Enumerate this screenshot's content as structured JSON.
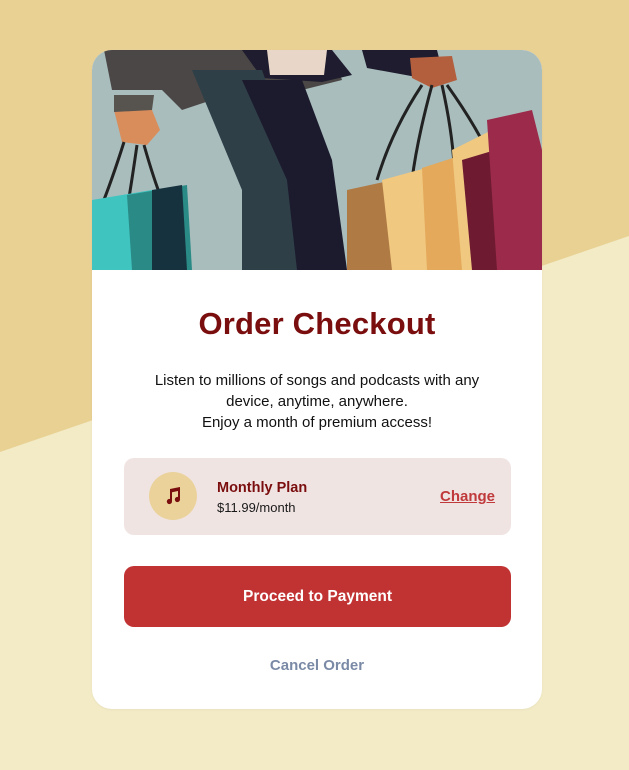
{
  "colors": {
    "background_top": "#e9d194",
    "background_bottom": "#f2ebc6",
    "card": "#ffffff",
    "title": "#7a0d0d",
    "accent": "#c13233",
    "plan_box": "#f0e4e3",
    "plan_icon_bg": "#ead29a",
    "cancel": "#7a8aa6"
  },
  "hero": {
    "image": "shopping-bags-illustration"
  },
  "checkout": {
    "title": "Order Checkout",
    "description_lines": [
      "Listen to millions of songs and podcasts with any",
      "device, anytime, anywhere.",
      "Enjoy a month of premium access!"
    ]
  },
  "plan": {
    "icon": "music-note-icon",
    "name": "Monthly Plan",
    "price": "$11.99/month",
    "change_label": "Change"
  },
  "actions": {
    "proceed_label": "Proceed to Payment",
    "cancel_label": "Cancel Order"
  }
}
